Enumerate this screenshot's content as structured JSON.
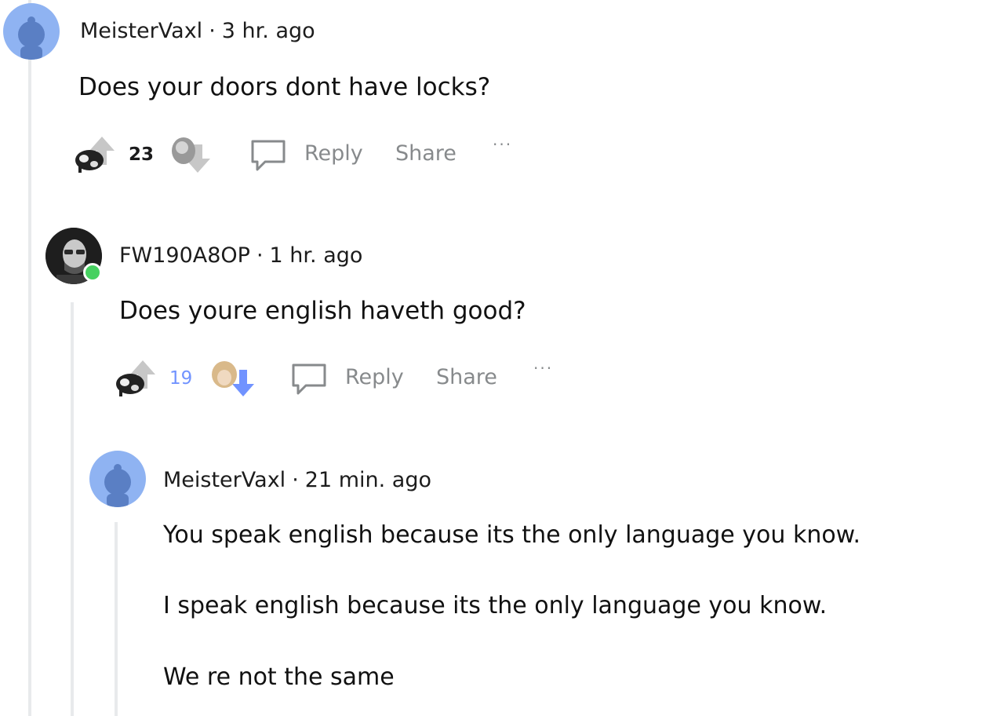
{
  "comments": [
    {
      "username": "MeisterVaxl",
      "separator": "·",
      "time": "3 hr. ago",
      "body": [
        "Does your doors dont have locks?"
      ],
      "score": "23",
      "reply_label": "Reply",
      "share_label": "Share",
      "more_label": "···"
    },
    {
      "username": "FW190A8OP",
      "separator": "·",
      "time": "1 hr. ago",
      "body": [
        "Does youre english haveth good?"
      ],
      "score": "19",
      "reply_label": "Reply",
      "share_label": "Share",
      "more_label": "···"
    },
    {
      "username": "MeisterVaxl",
      "separator": "·",
      "time": "21 min. ago",
      "body": [
        "You speak english because its the only language you know.",
        "I speak english because its the only language you know.",
        "We re not the same"
      ]
    }
  ],
  "icons": {
    "avatar_default": "reddit-snoo-avatar-icon",
    "avatar_user2": "user-photo-avatar-icon",
    "upvote": "upvote-arrow-icon",
    "downvote": "downvote-arrow-icon",
    "reply": "speech-bubble-icon"
  },
  "colors": {
    "avatar_blue": "#8fb3f2",
    "online_green": "#46d160",
    "downvote_blue": "#7193ff",
    "muted_text": "#878a8c"
  }
}
